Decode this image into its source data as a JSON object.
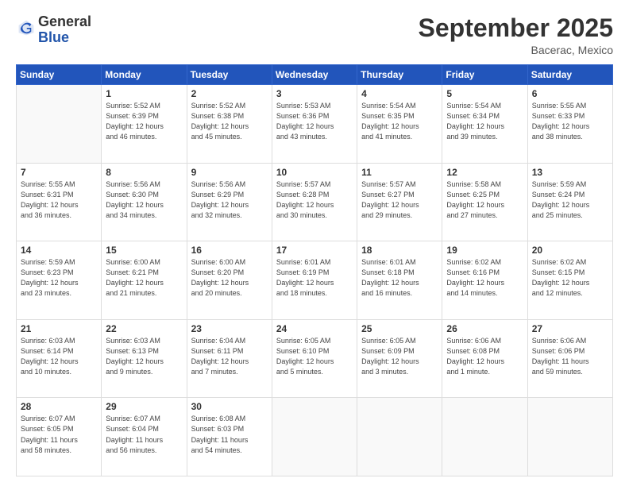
{
  "header": {
    "logo_general": "General",
    "logo_blue": "Blue",
    "month": "September 2025",
    "location": "Bacerac, Mexico"
  },
  "weekdays": [
    "Sunday",
    "Monday",
    "Tuesday",
    "Wednesday",
    "Thursday",
    "Friday",
    "Saturday"
  ],
  "weeks": [
    [
      {
        "day": "",
        "info": ""
      },
      {
        "day": "1",
        "info": "Sunrise: 5:52 AM\nSunset: 6:39 PM\nDaylight: 12 hours\nand 46 minutes."
      },
      {
        "day": "2",
        "info": "Sunrise: 5:52 AM\nSunset: 6:38 PM\nDaylight: 12 hours\nand 45 minutes."
      },
      {
        "day": "3",
        "info": "Sunrise: 5:53 AM\nSunset: 6:36 PM\nDaylight: 12 hours\nand 43 minutes."
      },
      {
        "day": "4",
        "info": "Sunrise: 5:54 AM\nSunset: 6:35 PM\nDaylight: 12 hours\nand 41 minutes."
      },
      {
        "day": "5",
        "info": "Sunrise: 5:54 AM\nSunset: 6:34 PM\nDaylight: 12 hours\nand 39 minutes."
      },
      {
        "day": "6",
        "info": "Sunrise: 5:55 AM\nSunset: 6:33 PM\nDaylight: 12 hours\nand 38 minutes."
      }
    ],
    [
      {
        "day": "7",
        "info": "Sunrise: 5:55 AM\nSunset: 6:31 PM\nDaylight: 12 hours\nand 36 minutes."
      },
      {
        "day": "8",
        "info": "Sunrise: 5:56 AM\nSunset: 6:30 PM\nDaylight: 12 hours\nand 34 minutes."
      },
      {
        "day": "9",
        "info": "Sunrise: 5:56 AM\nSunset: 6:29 PM\nDaylight: 12 hours\nand 32 minutes."
      },
      {
        "day": "10",
        "info": "Sunrise: 5:57 AM\nSunset: 6:28 PM\nDaylight: 12 hours\nand 30 minutes."
      },
      {
        "day": "11",
        "info": "Sunrise: 5:57 AM\nSunset: 6:27 PM\nDaylight: 12 hours\nand 29 minutes."
      },
      {
        "day": "12",
        "info": "Sunrise: 5:58 AM\nSunset: 6:25 PM\nDaylight: 12 hours\nand 27 minutes."
      },
      {
        "day": "13",
        "info": "Sunrise: 5:59 AM\nSunset: 6:24 PM\nDaylight: 12 hours\nand 25 minutes."
      }
    ],
    [
      {
        "day": "14",
        "info": "Sunrise: 5:59 AM\nSunset: 6:23 PM\nDaylight: 12 hours\nand 23 minutes."
      },
      {
        "day": "15",
        "info": "Sunrise: 6:00 AM\nSunset: 6:21 PM\nDaylight: 12 hours\nand 21 minutes."
      },
      {
        "day": "16",
        "info": "Sunrise: 6:00 AM\nSunset: 6:20 PM\nDaylight: 12 hours\nand 20 minutes."
      },
      {
        "day": "17",
        "info": "Sunrise: 6:01 AM\nSunset: 6:19 PM\nDaylight: 12 hours\nand 18 minutes."
      },
      {
        "day": "18",
        "info": "Sunrise: 6:01 AM\nSunset: 6:18 PM\nDaylight: 12 hours\nand 16 minutes."
      },
      {
        "day": "19",
        "info": "Sunrise: 6:02 AM\nSunset: 6:16 PM\nDaylight: 12 hours\nand 14 minutes."
      },
      {
        "day": "20",
        "info": "Sunrise: 6:02 AM\nSunset: 6:15 PM\nDaylight: 12 hours\nand 12 minutes."
      }
    ],
    [
      {
        "day": "21",
        "info": "Sunrise: 6:03 AM\nSunset: 6:14 PM\nDaylight: 12 hours\nand 10 minutes."
      },
      {
        "day": "22",
        "info": "Sunrise: 6:03 AM\nSunset: 6:13 PM\nDaylight: 12 hours\nand 9 minutes."
      },
      {
        "day": "23",
        "info": "Sunrise: 6:04 AM\nSunset: 6:11 PM\nDaylight: 12 hours\nand 7 minutes."
      },
      {
        "day": "24",
        "info": "Sunrise: 6:05 AM\nSunset: 6:10 PM\nDaylight: 12 hours\nand 5 minutes."
      },
      {
        "day": "25",
        "info": "Sunrise: 6:05 AM\nSunset: 6:09 PM\nDaylight: 12 hours\nand 3 minutes."
      },
      {
        "day": "26",
        "info": "Sunrise: 6:06 AM\nSunset: 6:08 PM\nDaylight: 12 hours\nand 1 minute."
      },
      {
        "day": "27",
        "info": "Sunrise: 6:06 AM\nSunset: 6:06 PM\nDaylight: 11 hours\nand 59 minutes."
      }
    ],
    [
      {
        "day": "28",
        "info": "Sunrise: 6:07 AM\nSunset: 6:05 PM\nDaylight: 11 hours\nand 58 minutes."
      },
      {
        "day": "29",
        "info": "Sunrise: 6:07 AM\nSunset: 6:04 PM\nDaylight: 11 hours\nand 56 minutes."
      },
      {
        "day": "30",
        "info": "Sunrise: 6:08 AM\nSunset: 6:03 PM\nDaylight: 11 hours\nand 54 minutes."
      },
      {
        "day": "",
        "info": ""
      },
      {
        "day": "",
        "info": ""
      },
      {
        "day": "",
        "info": ""
      },
      {
        "day": "",
        "info": ""
      }
    ]
  ]
}
